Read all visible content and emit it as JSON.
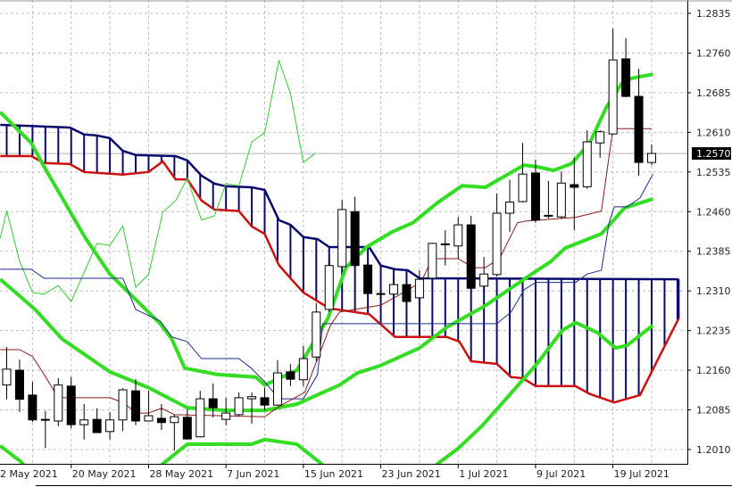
{
  "chart_data": {
    "type": "candlestick",
    "title": "",
    "colors": {
      "background": "#ffffff",
      "grid": "#c0c0c0",
      "bull_body": "#ffffff",
      "bear_body": "#000000",
      "candle_outline": "#000000",
      "tenkan": "#8b1a1a",
      "kijun": "#1c2a8c",
      "span_a": "#cc1111",
      "span_b": "#0a0a6e",
      "cloud_hatch": "#0a0a6e",
      "chikou": "#33cc33",
      "bollinger": "#33dd22",
      "current_price_bg": "#000000"
    },
    "y_axis": {
      "ticks": [
        "1.2835",
        "1.2760",
        "1.2685",
        "1.2610",
        "1.2535",
        "1.2460",
        "1.2385",
        "1.2310",
        "1.2235",
        "1.2160",
        "1.2085",
        "1.2010"
      ],
      "range": [
        1.196,
        1.286
      ]
    },
    "current_price": "1.2570",
    "x_axis": {
      "labels": [
        {
          "bar": -1,
          "text": "2 May 2021"
        },
        {
          "bar": 5,
          "text": "20 May 2021"
        },
        {
          "bar": 11,
          "text": "28 May 2021"
        },
        {
          "bar": 17,
          "text": "7 Jun 2021"
        },
        {
          "bar": 23,
          "text": "15 Jun 2021"
        },
        {
          "bar": 29,
          "text": "23 Jun 2021"
        },
        {
          "bar": 35,
          "text": "1 Jul 2021"
        },
        {
          "bar": 41,
          "text": "9 Jul 2021"
        },
        {
          "bar": 47,
          "text": "19 Jul 2021"
        }
      ]
    },
    "candles": [
      [
        1.2132,
        1.2204,
        1.2105,
        1.2162
      ],
      [
        1.216,
        1.218,
        1.2081,
        1.2105
      ],
      [
        1.2113,
        1.2138,
        1.2062,
        1.2066
      ],
      [
        1.2066,
        1.2083,
        1.2013,
        1.2067
      ],
      [
        1.2064,
        1.2145,
        1.2054,
        1.2132
      ],
      [
        1.213,
        1.2147,
        1.205,
        1.2057
      ],
      [
        1.2057,
        1.2096,
        1.2029,
        1.2066
      ],
      [
        1.2067,
        1.2088,
        1.2042,
        1.2042
      ],
      [
        1.2044,
        1.2081,
        1.2029,
        1.2066
      ],
      [
        1.2066,
        1.2126,
        1.2045,
        1.2123
      ],
      [
        1.2121,
        1.2143,
        1.2056,
        1.2064
      ],
      [
        1.2064,
        1.2121,
        1.2063,
        1.2074
      ],
      [
        1.2069,
        1.2096,
        1.2047,
        1.2061
      ],
      [
        1.2061,
        1.2076,
        1.2008,
        1.2072
      ],
      [
        1.2071,
        1.2086,
        1.2029,
        1.203
      ],
      [
        1.2034,
        1.2121,
        1.2033,
        1.2106
      ],
      [
        1.2106,
        1.2135,
        1.2071,
        1.2089
      ],
      [
        1.2067,
        1.2108,
        1.2056,
        1.2079
      ],
      [
        1.2076,
        1.2118,
        1.2072,
        1.2108
      ],
      [
        1.2106,
        1.2118,
        1.2059,
        1.211
      ],
      [
        1.2108,
        1.2127,
        1.2084,
        1.2094
      ],
      [
        1.2094,
        1.2179,
        1.2093,
        1.2155
      ],
      [
        1.2157,
        1.2172,
        1.213,
        1.2143
      ],
      [
        1.2142,
        1.2206,
        1.213,
        1.2182
      ],
      [
        1.2185,
        1.2287,
        1.2177,
        1.227
      ],
      [
        1.2275,
        1.2371,
        1.227,
        1.2358
      ],
      [
        1.2356,
        1.2482,
        1.2354,
        1.2464
      ],
      [
        1.246,
        1.2488,
        1.2354,
        1.2358
      ],
      [
        1.2359,
        1.2363,
        1.2304,
        1.2305
      ],
      [
        1.2304,
        1.2312,
        1.2295,
        1.2305
      ],
      [
        1.2304,
        1.2337,
        1.2295,
        1.2322
      ],
      [
        1.2322,
        1.2329,
        1.2287,
        1.229
      ],
      [
        1.2297,
        1.2349,
        1.2295,
        1.2332
      ],
      [
        1.2334,
        1.2401,
        1.2334,
        1.24
      ],
      [
        1.2398,
        1.2425,
        1.2358,
        1.2399
      ],
      [
        1.2395,
        1.245,
        1.2371,
        1.2435
      ],
      [
        1.2435,
        1.2452,
        1.2315,
        1.2315
      ],
      [
        1.2319,
        1.2374,
        1.2317,
        1.2342
      ],
      [
        1.2341,
        1.2494,
        1.2337,
        1.2457
      ],
      [
        1.2457,
        1.252,
        1.2422,
        1.2478
      ],
      [
        1.2479,
        1.259,
        1.2477,
        1.2531
      ],
      [
        1.2533,
        1.2558,
        1.2439,
        1.2444
      ],
      [
        1.2452,
        1.2518,
        1.2447,
        1.2453
      ],
      [
        1.245,
        1.2536,
        1.2447,
        1.2514
      ],
      [
        1.2511,
        1.2562,
        1.2425,
        1.2506
      ],
      [
        1.2507,
        1.2614,
        1.2503,
        1.2592
      ],
      [
        1.259,
        1.2614,
        1.2562,
        1.2611
      ],
      [
        1.2607,
        1.2806,
        1.2606,
        1.2747
      ],
      [
        1.2749,
        1.2788,
        1.2676,
        1.2678
      ],
      [
        1.2678,
        1.273,
        1.2528,
        1.2553
      ],
      [
        1.2553,
        1.2587,
        1.2548,
        1.257
      ]
    ],
    "candle_format": "[open, high, low, close]",
    "ichimoku": {
      "tenkan": [
        [
          -0.5,
          1.2199
        ],
        [
          1.0,
          1.2199
        ],
        [
          2.0,
          1.2186
        ],
        [
          2.9,
          1.2152
        ],
        [
          4.0,
          1.2108
        ],
        [
          8.0,
          1.2108
        ],
        [
          9.0,
          1.2099
        ],
        [
          10.1,
          1.2079
        ],
        [
          11.0,
          1.2079
        ],
        [
          12.0,
          1.2088
        ],
        [
          13.0,
          1.2076
        ],
        [
          20.0,
          1.2072
        ],
        [
          21.1,
          1.2091
        ],
        [
          23.1,
          1.2118
        ],
        [
          25.1,
          1.2245
        ],
        [
          25.8,
          1.227
        ],
        [
          27.0,
          1.2275
        ],
        [
          29.0,
          1.2283
        ],
        [
          30.1,
          1.2298
        ],
        [
          32.1,
          1.2326
        ],
        [
          33.0,
          1.2371
        ],
        [
          35.0,
          1.2371
        ],
        [
          36.2,
          1.2354
        ],
        [
          37.1,
          1.2354
        ],
        [
          38.2,
          1.2371
        ],
        [
          39.6,
          1.2439
        ],
        [
          40.2,
          1.2442
        ],
        [
          44.1,
          1.2449
        ],
        [
          46.1,
          1.2461
        ],
        [
          47.0,
          1.2617
        ],
        [
          50.0,
          1.2617
        ]
      ],
      "kijun": [
        [
          -0.5,
          1.2351
        ],
        [
          1.9,
          1.2351
        ],
        [
          2.9,
          1.2334
        ],
        [
          9.0,
          1.2334
        ],
        [
          10.0,
          1.2275
        ],
        [
          11.9,
          1.2253
        ],
        [
          12.8,
          1.2223
        ],
        [
          14.0,
          1.2214
        ],
        [
          15.1,
          1.2182
        ],
        [
          18.0,
          1.2182
        ],
        [
          19.0,
          1.2163
        ],
        [
          20.0,
          1.2138
        ],
        [
          21.1,
          1.2106
        ],
        [
          23.0,
          1.2106
        ],
        [
          24.1,
          1.2152
        ],
        [
          24.5,
          1.2248
        ],
        [
          38.0,
          1.2248
        ],
        [
          39.1,
          1.227
        ],
        [
          40.1,
          1.2312
        ],
        [
          41.0,
          1.2326
        ],
        [
          44.1,
          1.2326
        ],
        [
          45.0,
          1.2342
        ],
        [
          46.1,
          1.2349
        ],
        [
          46.7,
          1.2439
        ],
        [
          47.1,
          1.2469
        ],
        [
          48.1,
          1.2469
        ],
        [
          49.1,
          1.2486
        ],
        [
          50.1,
          1.2531
        ]
      ],
      "span_a": [
        [
          -0.5,
          1.2565
        ],
        [
          1.9,
          1.2565
        ],
        [
          2.9,
          1.2552
        ],
        [
          4.9,
          1.255
        ],
        [
          6.0,
          1.2535
        ],
        [
          9.0,
          1.253
        ],
        [
          11.0,
          1.2535
        ],
        [
          12.1,
          1.2555
        ],
        [
          13.1,
          1.2521
        ],
        [
          14.0,
          1.2521
        ],
        [
          15.1,
          1.2481
        ],
        [
          16.1,
          1.2464
        ],
        [
          18.0,
          1.2461
        ],
        [
          19.0,
          1.2432
        ],
        [
          20.0,
          1.2418
        ],
        [
          21.1,
          1.2359
        ],
        [
          22.0,
          1.2334
        ],
        [
          23.0,
          1.2307
        ],
        [
          25.0,
          1.2277
        ],
        [
          28.1,
          1.2266
        ],
        [
          30.1,
          1.2223
        ],
        [
          34.1,
          1.2223
        ],
        [
          35.1,
          1.2214
        ],
        [
          36.0,
          1.2177
        ],
        [
          38.0,
          1.2172
        ],
        [
          39.1,
          1.2147
        ],
        [
          40.0,
          1.2145
        ],
        [
          41.0,
          1.213
        ],
        [
          44.1,
          1.213
        ],
        [
          45.2,
          1.2115
        ],
        [
          47.1,
          1.2099
        ],
        [
          49.1,
          1.2113
        ],
        [
          50.1,
          1.2162
        ],
        [
          52.1,
          1.2258
        ]
      ],
      "span_b": [
        [
          -0.5,
          1.2624
        ],
        [
          1.9,
          1.2622
        ],
        [
          2.9,
          1.2621
        ],
        [
          4.9,
          1.2619
        ],
        [
          6.0,
          1.2606
        ],
        [
          7.0,
          1.2604
        ],
        [
          8.0,
          1.2599
        ],
        [
          9.0,
          1.2575
        ],
        [
          10.0,
          1.2567
        ],
        [
          13.1,
          1.2565
        ],
        [
          14.0,
          1.2557
        ],
        [
          15.1,
          1.2528
        ],
        [
          16.1,
          1.2513
        ],
        [
          17.0,
          1.2508
        ],
        [
          19.0,
          1.2506
        ],
        [
          20.0,
          1.2501
        ],
        [
          21.1,
          1.2444
        ],
        [
          22.0,
          1.2435
        ],
        [
          23.0,
          1.2412
        ],
        [
          24.1,
          1.2408
        ],
        [
          25.0,
          1.2393
        ],
        [
          28.1,
          1.2393
        ],
        [
          29.0,
          1.2358
        ],
        [
          30.1,
          1.2351
        ],
        [
          31.1,
          1.2349
        ],
        [
          32.0,
          1.2334
        ],
        [
          52.1,
          1.2332
        ]
      ],
      "chikou": [
        [
          -0.5,
          1.241
        ],
        [
          0,
          1.2462
        ],
        [
          1.0,
          1.2366
        ],
        [
          2.0,
          1.2307
        ],
        [
          2.9,
          1.2304
        ],
        [
          4.0,
          1.232
        ],
        [
          5.0,
          1.229
        ],
        [
          7.0,
          1.24
        ],
        [
          8.0,
          1.2396
        ],
        [
          9.0,
          1.2433
        ],
        [
          10.0,
          1.2317
        ],
        [
          11.0,
          1.2341
        ],
        [
          12.1,
          1.2459
        ],
        [
          13.1,
          1.2481
        ],
        [
          14.0,
          1.2523
        ],
        [
          15.1,
          1.2444
        ],
        [
          16.1,
          1.2452
        ],
        [
          17.0,
          1.2513
        ],
        [
          18.0,
          1.2509
        ],
        [
          19.0,
          1.2592
        ],
        [
          20.0,
          1.2609
        ],
        [
          21.1,
          1.2746
        ],
        [
          22.0,
          1.2683
        ],
        [
          23.0,
          1.2553
        ],
        [
          23.9,
          1.257
        ]
      ]
    },
    "bollinger": {
      "upper": [
        [
          -0.5,
          1.2648
        ],
        [
          1.9,
          1.259
        ],
        [
          2.9,
          1.2545
        ],
        [
          6.1,
          1.241
        ],
        [
          8.0,
          1.2342
        ],
        [
          11.9,
          1.2248
        ],
        [
          12.8,
          1.2219
        ],
        [
          13.8,
          1.2164
        ],
        [
          16.3,
          1.2152
        ],
        [
          19.3,
          1.2147
        ],
        [
          20.0,
          1.2132
        ],
        [
          22.5,
          1.216
        ],
        [
          24.9,
          1.2258
        ],
        [
          26.3,
          1.2354
        ],
        [
          27.9,
          1.2393
        ],
        [
          29.9,
          1.2422
        ],
        [
          31.5,
          1.2439
        ],
        [
          33.4,
          1.2477
        ],
        [
          35.3,
          1.2509
        ],
        [
          37.1,
          1.2506
        ],
        [
          40.1,
          1.2548
        ],
        [
          41.1,
          1.2545
        ],
        [
          42.4,
          1.2538
        ],
        [
          43.8,
          1.2551
        ],
        [
          45.2,
          1.259
        ],
        [
          46.5,
          1.2658
        ],
        [
          47.7,
          1.2703
        ],
        [
          48.4,
          1.2712
        ],
        [
          50.1,
          1.272
        ]
      ],
      "middle": [
        [
          -0.5,
          1.2332
        ],
        [
          2.2,
          1.2275
        ],
        [
          4.3,
          1.2219
        ],
        [
          8.0,
          1.2157
        ],
        [
          11.0,
          1.2127
        ],
        [
          14.0,
          1.2089
        ],
        [
          17.0,
          1.2084
        ],
        [
          20.0,
          1.2084
        ],
        [
          22.5,
          1.2096
        ],
        [
          25.8,
          1.2132
        ],
        [
          27.2,
          1.2155
        ],
        [
          29.0,
          1.2169
        ],
        [
          32.0,
          1.2202
        ],
        [
          34.1,
          1.2241
        ],
        [
          37.1,
          1.2282
        ],
        [
          40.1,
          1.2332
        ],
        [
          42.2,
          1.2366
        ],
        [
          43.3,
          1.2391
        ],
        [
          46.1,
          1.2418
        ],
        [
          47.9,
          1.2467
        ],
        [
          50.1,
          1.2484
        ]
      ],
      "lower": [
        [
          -0.5,
          1.2017
        ],
        [
          1.1,
          1.1987
        ],
        [
          2.6,
          1.1941
        ],
        [
          10.6,
          1.1941
        ],
        [
          12.1,
          1.1983
        ],
        [
          14.0,
          1.202
        ],
        [
          19.0,
          1.202
        ],
        [
          20.0,
          1.2029
        ],
        [
          22.5,
          1.202
        ],
        [
          24.4,
          1.1983
        ],
        [
          25.8,
          1.1941
        ],
        [
          32.0,
          1.1941
        ],
        [
          33.4,
          1.1983
        ],
        [
          35.0,
          1.2012
        ],
        [
          36.9,
          1.2056
        ],
        [
          41.0,
          1.2169
        ],
        [
          43.1,
          1.2236
        ],
        [
          44.1,
          1.225
        ],
        [
          45.8,
          1.2231
        ],
        [
          47.2,
          1.2202
        ],
        [
          48.1,
          1.2207
        ],
        [
          50.1,
          1.2245
        ]
      ]
    },
    "grid": true
  }
}
